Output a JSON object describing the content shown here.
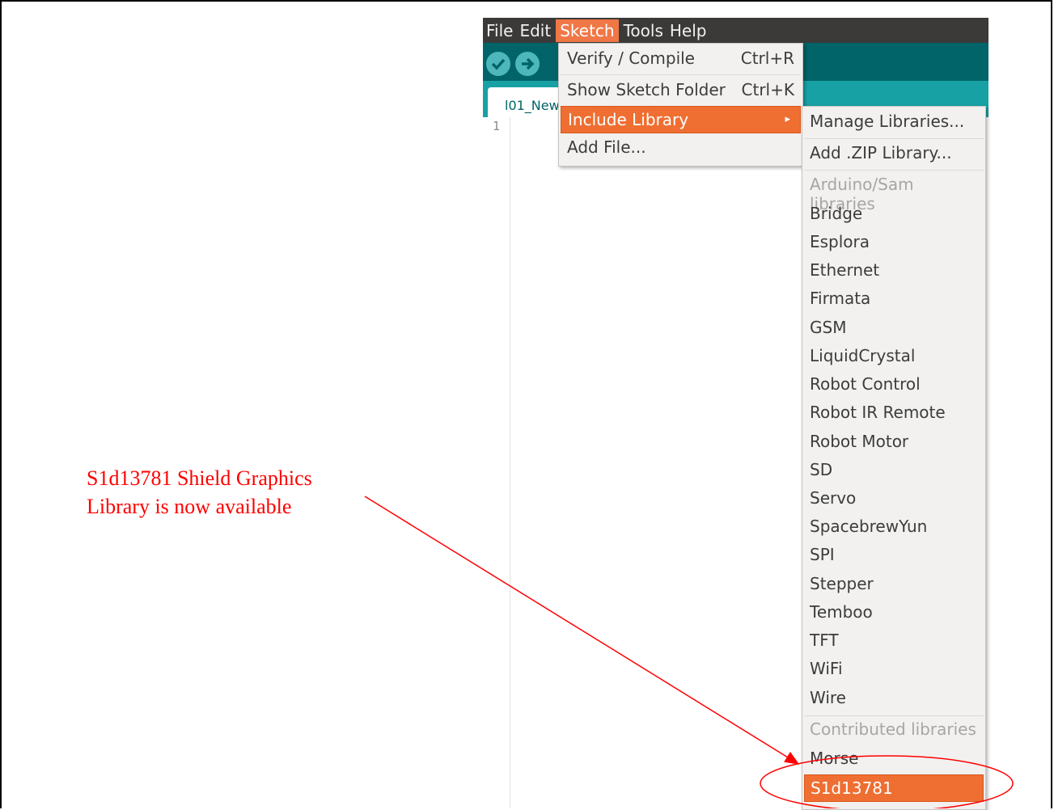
{
  "menubar": {
    "items": [
      "File",
      "Edit",
      "Sketch",
      "Tools",
      "Help"
    ],
    "active": "Sketch"
  },
  "toolbar": {
    "verify_icon": "check-icon",
    "upload_icon": "arrow-right-icon"
  },
  "tab": {
    "label": "l01_New"
  },
  "editor": {
    "line_numbers": [
      "1"
    ]
  },
  "sketch_menu": {
    "items": [
      {
        "label": "Verify / Compile",
        "shortcut": "Ctrl+R"
      },
      {
        "label": "Show Sketch Folder",
        "shortcut": "Ctrl+K"
      },
      {
        "label": "Include Library",
        "submenu_icon": "submenu-arrow-icon"
      },
      {
        "label": "Add File..."
      }
    ]
  },
  "library_menu": {
    "manage": "Manage Libraries...",
    "add_zip": "Add .ZIP Library...",
    "arduino_header": "Arduino/Sam libraries",
    "arduino_libraries": [
      "Bridge",
      "Esplora",
      "Ethernet",
      "Firmata",
      "GSM",
      "LiquidCrystal",
      "Robot Control",
      "Robot IR Remote",
      "Robot Motor",
      "SD",
      "Servo",
      "SpacebrewYun",
      "SPI",
      "Stepper",
      "Temboo",
      "TFT",
      "WiFi",
      "Wire"
    ],
    "contributed_header": "Contributed libraries",
    "contributed_libraries": [
      "Morse",
      "S1d13781"
    ]
  },
  "annotation": {
    "line1": "S1d13781 Shield Graphics",
    "line2": "Library is now available",
    "color": "#ff0000"
  },
  "colors": {
    "menubar": "#3b3a39",
    "toolbar": "#006468",
    "tabstrip": "#17a1a5",
    "highlight": "#ef6e31",
    "menu_bg": "#f2f1f0"
  }
}
